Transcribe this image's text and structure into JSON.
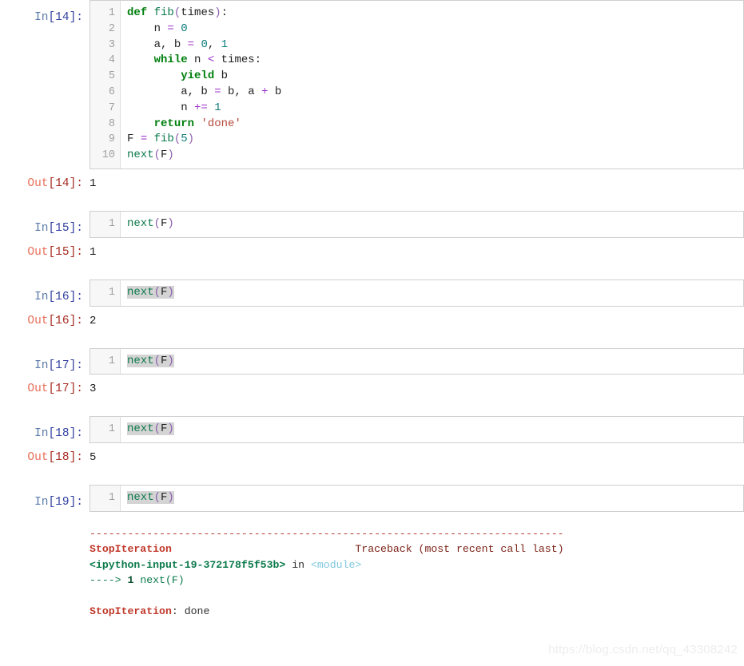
{
  "notebook": {
    "cells": [
      {
        "type": "code",
        "prompt_label": "In",
        "prompt_index": "[14]:",
        "line_numbers": "1\n2\n3\n4\n5\n6\n7\n8\n9\n10",
        "source_plain": "def fib(times):\n    n = 0\n    a, b = 0, 1\n    while n < times:\n        yield b\n        a, b = b, a + b\n        n += 1\n    return 'done'\nF = fib(5)\nnext(F)",
        "selected": false,
        "output": {
          "prompt_label": "Out",
          "prompt_index": "[14]:",
          "value": "1"
        }
      },
      {
        "type": "code",
        "prompt_label": "In",
        "prompt_index": "[15]:",
        "line_numbers": "1",
        "source_plain": "next(F)",
        "selected": false,
        "output": {
          "prompt_label": "Out",
          "prompt_index": "[15]:",
          "value": "1"
        }
      },
      {
        "type": "code",
        "prompt_label": "In",
        "prompt_index": "[16]:",
        "line_numbers": "1",
        "source_plain": "next(F)",
        "selected": true,
        "output": {
          "prompt_label": "Out",
          "prompt_index": "[16]:",
          "value": "2"
        }
      },
      {
        "type": "code",
        "prompt_label": "In",
        "prompt_index": "[17]:",
        "line_numbers": "1",
        "source_plain": "next(F)",
        "selected": true,
        "output": {
          "prompt_label": "Out",
          "prompt_index": "[17]:",
          "value": "3"
        }
      },
      {
        "type": "code",
        "prompt_label": "In",
        "prompt_index": "[18]:",
        "line_numbers": "1",
        "source_plain": "next(F)",
        "selected": true,
        "output": {
          "prompt_label": "Out",
          "prompt_index": "[18]:",
          "value": "5"
        }
      },
      {
        "type": "code",
        "prompt_label": "In",
        "prompt_index": "[19]:",
        "line_numbers": "1",
        "source_plain": "next(F)",
        "selected": true,
        "output": null
      }
    ],
    "traceback": {
      "rule": "---------------------------------------------------------------------------",
      "exception_name": "StopIteration",
      "header_label": "Traceback (most recent call last)",
      "frame_file": "<ipython-input-19-372178f5f53b>",
      "frame_in": " in ",
      "frame_scope": "<module>",
      "arrow": "----> ",
      "arrow_lineno": "1",
      "arrow_code": " next(F)",
      "final_exception": "StopIteration",
      "final_message": ": done"
    }
  },
  "watermark": {
    "text": "https://blog.csdn.net/qq_43308242"
  },
  "colors": {
    "in_prompt": "#5b7ba8",
    "in_bracket": "#303f9f",
    "out_prompt": "#e8705a",
    "out_bracket": "#a62a20",
    "keyword": "#007f0e",
    "function": "#0b7a4b",
    "number": "#0f7a7a",
    "operator": "#9b30c9",
    "string": "#b5493b",
    "selection": "#d4d4d4",
    "cell_border": "#cfcfcf",
    "gutter_bg": "#f7f7f7",
    "traceback_red": "#c0392b"
  }
}
